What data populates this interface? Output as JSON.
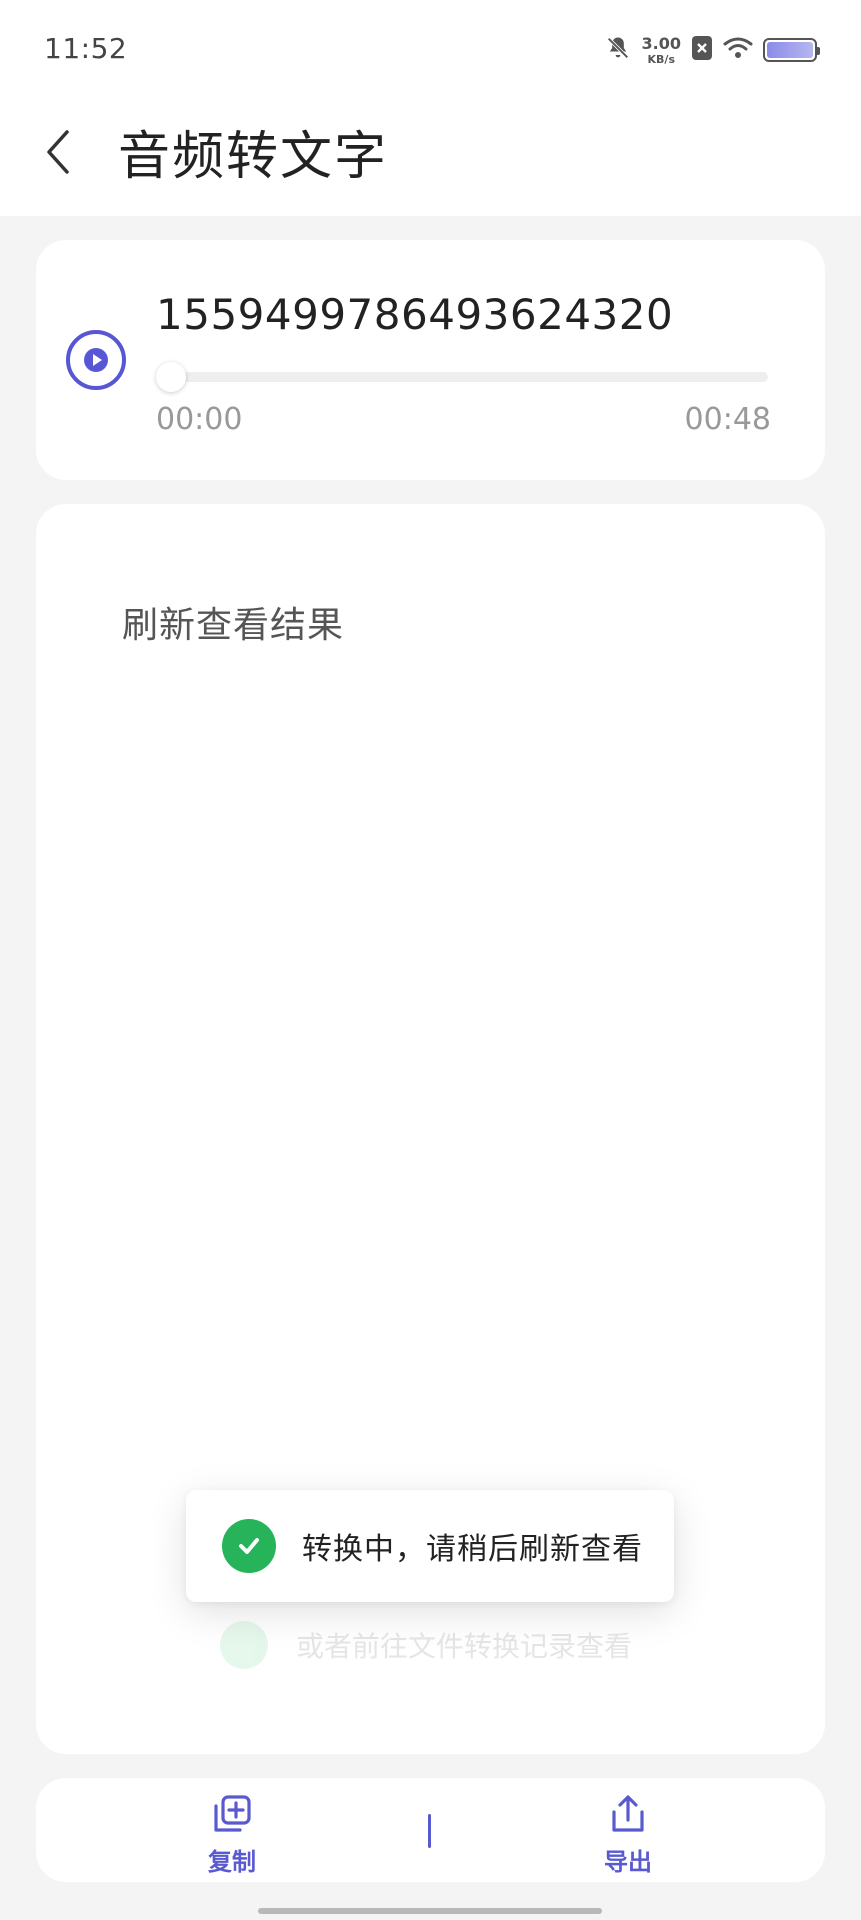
{
  "status_bar": {
    "time": "11:52",
    "net_speed_value": "3.00",
    "net_speed_unit": "KB/s",
    "icons": [
      "bell-muted-icon",
      "no-sim-icon",
      "wifi-icon",
      "battery-icon"
    ],
    "battery_level": 1.0
  },
  "header": {
    "title": "音频转文字",
    "back_icon": "chevron-left-icon"
  },
  "player": {
    "file_name": "1559499786493624320",
    "current_time": "00:00",
    "total_time": "00:48",
    "progress": 0.0,
    "play_icon": "play-icon"
  },
  "result": {
    "text": "刷新查看结果"
  },
  "toast": {
    "message": "转换中，请稍后刷新查看",
    "ghost_message": "或者前往文件转换记录查看",
    "icon": "check-circle-icon"
  },
  "actions": {
    "copy_label": "复制",
    "export_label": "导出",
    "copy_icon": "copy-add-icon",
    "export_icon": "share-export-icon"
  },
  "colors": {
    "accent": "#5757d6",
    "success": "#27b35a",
    "background": "#f4f4f4"
  }
}
